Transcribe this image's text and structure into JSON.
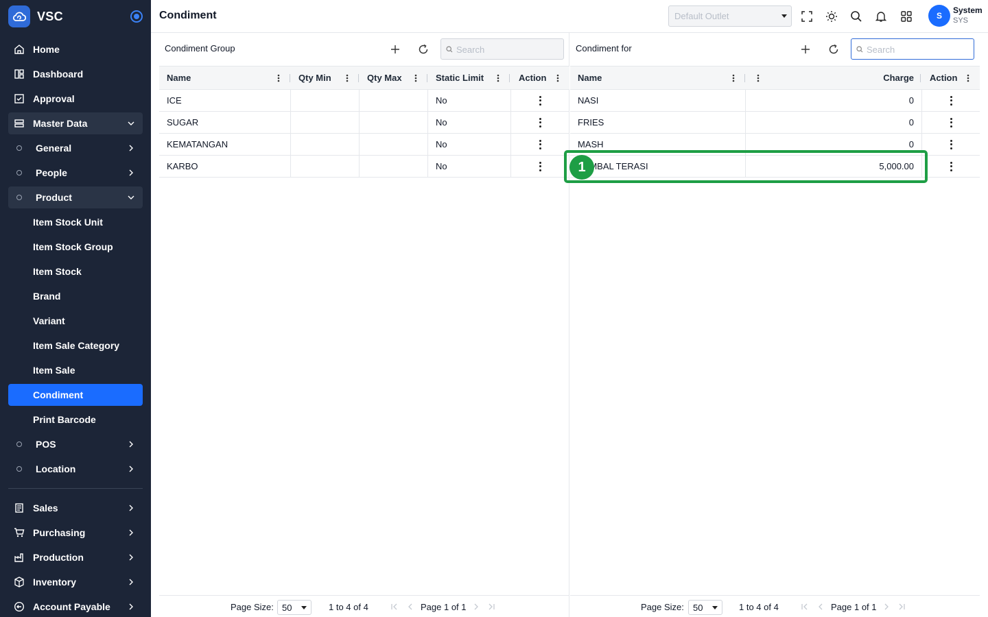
{
  "brand": {
    "name": "VSC"
  },
  "sidebar": {
    "home": "Home",
    "dashboard": "Dashboard",
    "approval": "Approval",
    "master_data": "Master Data",
    "general": "General",
    "people": "People",
    "product": "Product",
    "product_items": [
      "Item Stock Unit",
      "Item Stock Group",
      "Item Stock",
      "Brand",
      "Variant",
      "Item Sale Category",
      "Item Sale",
      "Condiment",
      "Print Barcode"
    ],
    "pos": "POS",
    "location": "Location",
    "sales": "Sales",
    "purchasing": "Purchasing",
    "production": "Production",
    "inventory": "Inventory",
    "account_payable": "Account Payable"
  },
  "header": {
    "title": "Condiment",
    "outlet_placeholder": "Default Outlet",
    "user_initial": "S",
    "user_name": "System",
    "user_code": "SYS"
  },
  "left_panel": {
    "title": "Condiment Group",
    "search_placeholder": "Search",
    "columns": [
      "Name",
      "Qty Min",
      "Qty Max",
      "Static Limit",
      "Action"
    ],
    "rows": [
      {
        "name": "ICE",
        "qty_min": "",
        "qty_max": "",
        "static_limit": "No"
      },
      {
        "name": "SUGAR",
        "qty_min": "",
        "qty_max": "",
        "static_limit": "No"
      },
      {
        "name": "KEMATANGAN",
        "qty_min": "",
        "qty_max": "",
        "static_limit": "No"
      },
      {
        "name": "KARBO",
        "qty_min": "",
        "qty_max": "",
        "static_limit": "No"
      }
    ],
    "footer": {
      "page_size_label": "Page Size:",
      "page_size": "50",
      "range": "1 to 4 of 4",
      "page_label": "Page 1 of 1"
    }
  },
  "right_panel": {
    "title": "Condiment for",
    "search_placeholder": "Search",
    "columns": [
      "Name",
      "Charge",
      "Action"
    ],
    "rows": [
      {
        "name": "NASI",
        "charge": "0"
      },
      {
        "name": "FRIES",
        "charge": "0"
      },
      {
        "name": "MASH",
        "charge": "0"
      },
      {
        "name": "SAMBAL TERASI",
        "charge": "5,000.00"
      }
    ],
    "footer": {
      "page_size_label": "Page Size:",
      "page_size": "50",
      "range": "1 to 4 of 4",
      "page_label": "Page 1 of 1"
    }
  },
  "annotation": {
    "number": "1"
  },
  "colors": {
    "sidebar_bg": "#1c2537",
    "accent": "#1a6cff",
    "highlight": "#1e9e45"
  }
}
